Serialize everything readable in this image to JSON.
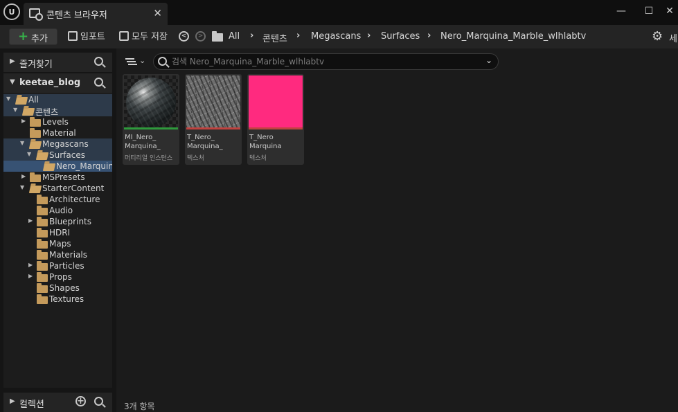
{
  "window": {
    "tab_title": "콘텐츠 브라우저",
    "tab_close": "✕",
    "minimize": "—",
    "maximize": "☐",
    "close": "✕"
  },
  "toolbar": {
    "add_label": "추가",
    "import_label": "임포트",
    "save_all_label": "모두 저장",
    "settings_label": "세"
  },
  "breadcrumb": [
    "All",
    "콘텐츠",
    "Megascans",
    "Surfaces",
    "Nero_Marquina_Marble_wlhlabtv"
  ],
  "favorites": {
    "title": "즐겨찾기"
  },
  "project": {
    "title": "keetae_blog"
  },
  "tree": [
    {
      "label": "All",
      "state": "open"
    },
    {
      "label": "콘텐츠",
      "state": "open"
    },
    {
      "label": "Levels",
      "state": "collapsed"
    },
    {
      "label": "Material",
      "state": "leaf"
    },
    {
      "label": "Megascans",
      "state": "open"
    },
    {
      "label": "Surfaces",
      "state": "open"
    },
    {
      "label": "Nero_Marquina_Marble_wlhlabtv",
      "state": "selected"
    },
    {
      "label": "MSPresets",
      "state": "collapsed"
    },
    {
      "label": "StarterContent",
      "state": "open"
    },
    {
      "label": "Architecture",
      "state": "leaf"
    },
    {
      "label": "Audio",
      "state": "leaf"
    },
    {
      "label": "Blueprints",
      "state": "collapsed"
    },
    {
      "label": "HDRI",
      "state": "leaf"
    },
    {
      "label": "Maps",
      "state": "leaf"
    },
    {
      "label": "Materials",
      "state": "leaf"
    },
    {
      "label": "Particles",
      "state": "collapsed"
    },
    {
      "label": "Props",
      "state": "collapsed"
    },
    {
      "label": "Shapes",
      "state": "leaf"
    },
    {
      "label": "Textures",
      "state": "leaf"
    }
  ],
  "collections": {
    "title": "컬렉션"
  },
  "search": {
    "placeholder": "검색 Nero_Marquina_Marble_wlhlabtv"
  },
  "assets": [
    {
      "name": "MI_Nero_\nMarquina_",
      "type": "머티리얼 인스턴스",
      "thumb": "sphere",
      "accent": "#2e9a3c"
    },
    {
      "name": "T_Nero_\nMarquina_",
      "type": "텍스처",
      "thumb": "texture",
      "accent": "#c0423f"
    },
    {
      "name": "T_Nero\nMarquina",
      "type": "텍스처",
      "thumb": "pink",
      "accent": "#c0423f",
      "color": "#ff2a7f"
    }
  ],
  "status": {
    "item_count": "3개 항목"
  }
}
